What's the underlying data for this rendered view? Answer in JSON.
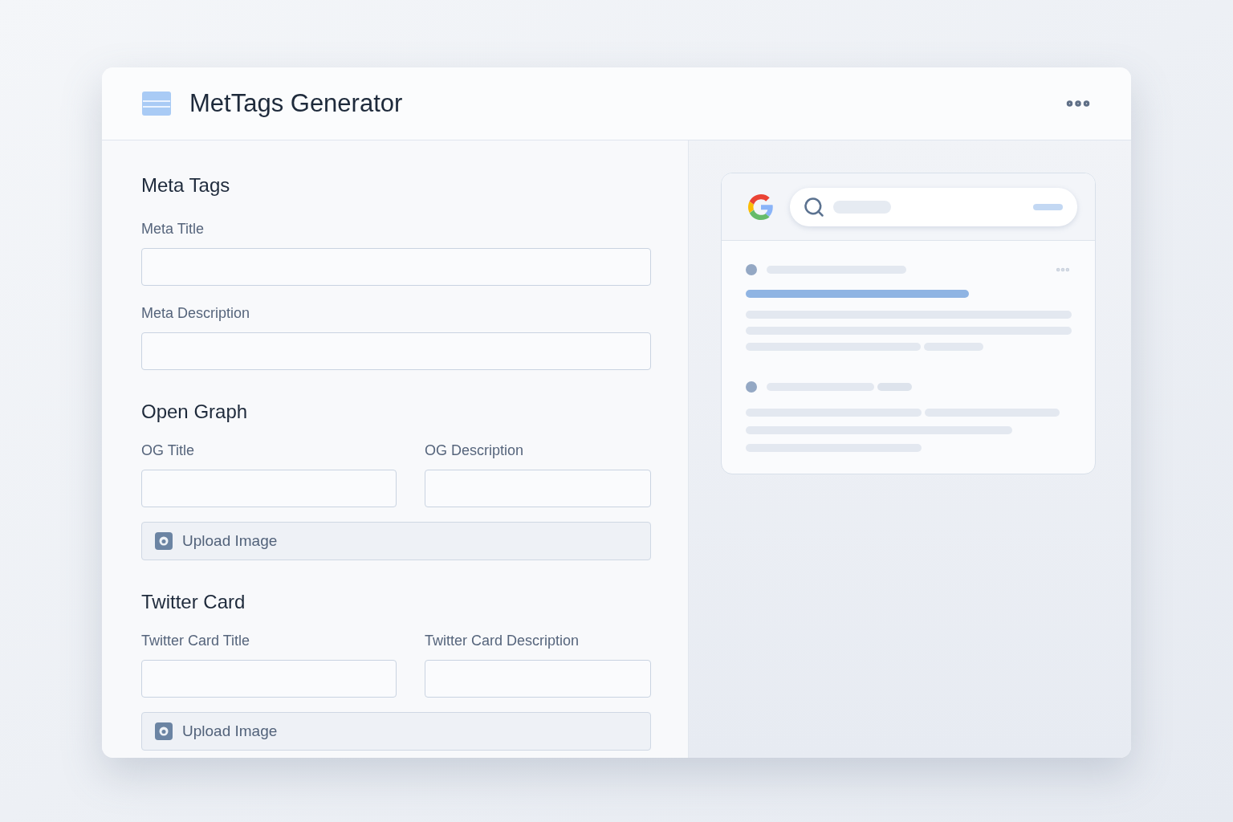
{
  "window": {
    "title": "MetTags Generator"
  },
  "sections": [
    {
      "heading": "Meta Tags",
      "items": [
        {
          "kind": "field",
          "label": "Meta Title"
        },
        {
          "kind": "field",
          "label": "Meta Description"
        }
      ]
    },
    {
      "heading": "Open Graph",
      "items": [
        {
          "kind": "pair",
          "fields": [
            {
              "label": "OG Title"
            },
            {
              "label": "OG Description"
            }
          ]
        },
        {
          "kind": "upload",
          "label": "Upload Image"
        }
      ]
    },
    {
      "heading": "Twitter Card",
      "items": [
        {
          "kind": "pair",
          "fields": [
            {
              "label": "Twitter Card Title"
            },
            {
              "label": "Twitter Card Description"
            }
          ]
        },
        {
          "kind": "upload",
          "label": "Upload Image"
        }
      ]
    }
  ]
}
